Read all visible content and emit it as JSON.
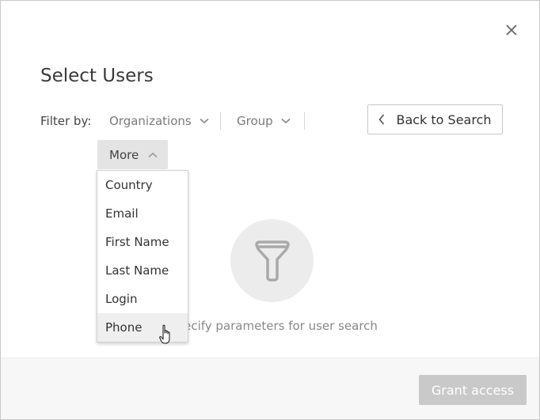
{
  "dialog": {
    "title": "Select Users",
    "close_icon": "close-icon"
  },
  "filter": {
    "label": "Filter by:",
    "organizations_label": "Organizations",
    "group_label": "Group",
    "more_label": "More",
    "back_to_search_label": "Back to Search"
  },
  "more_menu": {
    "items": [
      "Country",
      "Email",
      "First Name",
      "Last Name",
      "Login",
      "Phone"
    ],
    "hovered": "Phone"
  },
  "empty_state": {
    "icon": "funnel-icon",
    "message": "Specify parameters for user search"
  },
  "footer": {
    "grant_access_label": "Grant access"
  },
  "colors": {
    "disabled_button": "#c9c9c9",
    "more_button_bg": "#e4e4e4",
    "empty_circle": "#ececec"
  }
}
